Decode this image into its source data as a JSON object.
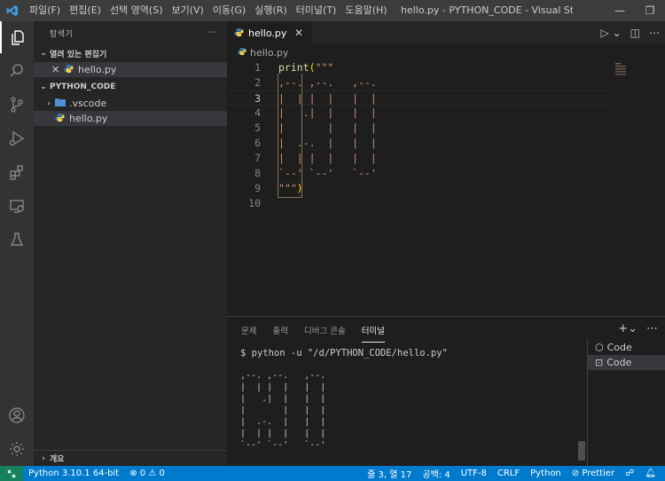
{
  "menu": [
    "파일(F)",
    "편집(E)",
    "선택 영역(S)",
    "보기(V)",
    "이동(G)",
    "실행(R)",
    "터미널(T)",
    "도움말(H)"
  ],
  "window_title": "hello.py - PYTHON_CODE - Visual Studio Co...",
  "sidebar": {
    "title": "탐색기",
    "open_editors_label": "열려 있는 편집기",
    "open_editor_file": "hello.py",
    "folder_label": "PYTHON_CODE",
    "items": [
      {
        "label": ".vscode",
        "type": "folder"
      },
      {
        "label": "hello.py",
        "type": "python-file"
      }
    ],
    "outline_label": "개요"
  },
  "tab": {
    "label": "hello.py"
  },
  "breadcrumb": "hello.py",
  "editor": {
    "current_line": 3,
    "lines": [
      {
        "n": "1",
        "text": "print(\"\"\""
      },
      {
        "n": "2",
        "text": ",--. ,--.   ,--."
      },
      {
        "n": "3",
        "text": "|  | |  |   |  |"
      },
      {
        "n": "4",
        "text": "|   .|  |   |  |"
      },
      {
        "n": "5",
        "text": "|       |   |  |"
      },
      {
        "n": "6",
        "text": "|  .-.  |   |  |"
      },
      {
        "n": "7",
        "text": "|  | |  |   |  |"
      },
      {
        "n": "8",
        "text": "`--' `--'   `--'"
      },
      {
        "n": "9",
        "text": "\"\"\")"
      },
      {
        "n": "10",
        "text": ""
      }
    ]
  },
  "panel": {
    "tabs": [
      "문제",
      "출력",
      "디버그 콘솔",
      "터미널"
    ],
    "active_tab": "터미널",
    "terminal_command": "$ python -u \"/d/PYTHON_CODE/hello.py\"",
    "terminal_output": ",--. ,--.   ,--.\n|  | |  |   |  |\n|   .|  |   |  |\n|       |   |  |\n|  .-.  |   |  |\n|  | |  |   |  |\n`--' `--'   `--'",
    "terminals": [
      "Code",
      "Code"
    ]
  },
  "statusbar": {
    "interpreter": "Python 3.10.1 64-bit",
    "errors": "0",
    "warnings": "0",
    "position": "줄 3, 열 17",
    "spaces": "공백: 4",
    "encoding": "UTF-8",
    "eol": "CRLF",
    "language": "Python",
    "formatter": "Prettier"
  },
  "colors": {
    "statusbar": "#007acc",
    "activitybar": "#333333",
    "sidebar": "#252526",
    "editor": "#1e1e1e",
    "string": "#ce9178",
    "function": "#dcdcaa"
  }
}
